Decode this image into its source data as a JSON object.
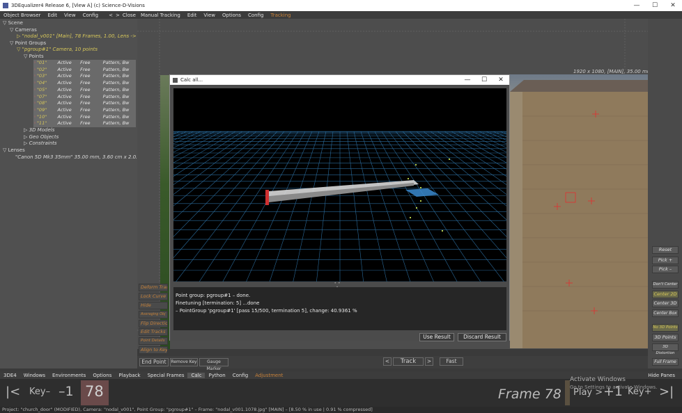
{
  "window": {
    "title": "3DEqualizer4 Release 6, [View A]   (c) Science-D-Visions",
    "controls": [
      "—",
      "☐",
      "✕"
    ]
  },
  "left_menu": {
    "items": [
      "Object Browser",
      "Edit",
      "View",
      "Config"
    ],
    "right": [
      "<",
      ">",
      "Close"
    ]
  },
  "tree": {
    "scene": "Scene",
    "cameras": "Cameras",
    "camera_item": "\"nodal_v001\"  [Main], 78 Frames, 1.00, Lens -> \"",
    "point_groups": "Point Groups",
    "pgroup": "\"pgroup#1\"   Camera, 10 points",
    "points": "Points",
    "point_rows": [
      {
        "name": "\"01\"",
        "status": "Active",
        "mode": "Free",
        "type": "Pattern, Bw"
      },
      {
        "name": "\"02\"",
        "status": "Active",
        "mode": "Free",
        "type": "Pattern, Bw"
      },
      {
        "name": "\"03\"",
        "status": "Active",
        "mode": "Free",
        "type": "Pattern, Bw"
      },
      {
        "name": "\"04\"",
        "status": "Active",
        "mode": "Free",
        "type": "Pattern, Bw"
      },
      {
        "name": "\"05\"",
        "status": "Active",
        "mode": "Free",
        "type": "Pattern, Bw"
      },
      {
        "name": "\"07\"",
        "status": "Active",
        "mode": "Free",
        "type": "Pattern, Bw"
      },
      {
        "name": "\"08\"",
        "status": "Active",
        "mode": "Free",
        "type": "Pattern, Bw"
      },
      {
        "name": "\"09\"",
        "status": "Active",
        "mode": "Free",
        "type": "Pattern, Bw"
      },
      {
        "name": "\"10\"",
        "status": "Active",
        "mode": "Free",
        "type": "Pattern, Bw"
      },
      {
        "name": "\"11\"",
        "status": "Active",
        "mode": "Free",
        "type": "Pattern, Bw"
      }
    ],
    "models": "3D Models",
    "geo": "Geo Objects",
    "constraints": "Constraints",
    "lenses": "Lenses",
    "lens_item": "\"Canon 5D Mk3 35mm\"   35.00 mm, 3.60 cm x 2.02 c"
  },
  "right_menu": {
    "items": [
      "Manual Tracking",
      "Edit",
      "View",
      "Options",
      "Config"
    ],
    "active": "Tracking"
  },
  "viewport": {
    "info": "1920 x 1080, [MAIN], 35.00 mm"
  },
  "left_tools": [
    "Deform Track",
    "Lock Curve",
    "Hide",
    "Averaging Obj",
    "Flip Direction",
    "Edit Tracks",
    "Point Details",
    "Align to Key"
  ],
  "right_tools": {
    "reset": "Reset",
    "pick_plus": "Pick +",
    "pick_minus": "Pick –",
    "dont_center": "Don't Center",
    "center_2d": "Center 2D",
    "center_3d": "Center 3D",
    "center_box": "Center Box",
    "no_3d_points": "No 3D Points",
    "points_3d": "3D Points",
    "distortion_3d": "3D Distortion",
    "full_frame": "Full Frame"
  },
  "dialog": {
    "title": "Calc all...",
    "controls": [
      "—",
      "☐",
      "✕"
    ],
    "console_lines": [
      "Point group: pgroup#1 –  done.",
      "Finetuning [termination: 5] ...done",
      "– PointGroup 'pgroup#1'  [pass 15/500, termination 5], change: 40.9361 %"
    ],
    "use_result": "Use Result",
    "discard_result": "Discard Result"
  },
  "track_bar": {
    "end_point": "End Point",
    "remove_key": "Remove Key",
    "gauge_marker": "Gauge Marker",
    "prev": "<",
    "track": "Track",
    "next": ">",
    "fast": "Fast"
  },
  "bottom_menu": {
    "items": [
      "3DE4",
      "Windows",
      "Environments",
      "Options",
      "Playback",
      "Special Frames"
    ],
    "calc": "Calc",
    "items2": [
      "Python",
      "Config"
    ],
    "active": "Adjustment",
    "hide_panes": "Hide Panes"
  },
  "timeline": {
    "to_start": "|<",
    "key_prev": "Key–",
    "minus_one": "–1",
    "frame_value": "78",
    "frame_label": "Frame 78",
    "play": "Play >",
    "plus_one": "+1",
    "key_next": "Key+",
    "to_end": ">|"
  },
  "watermark": {
    "line1": "Activate Windows",
    "line2": "Go to Settings to activate Windows."
  },
  "status": "Project: \"church_door\" (MODIFIED), Camera: \"nodal_v001\", Point Group: \"pgroup#1\" – Frame: \"nodal_v001.1078.jpg\" [MAIN] – [8.50 % in use | 0.91 % compressed]",
  "colors": {
    "accent_orange": "#c8823a",
    "accent_yellow": "#d8c85a",
    "grid_blue": "#2a6a9a"
  }
}
